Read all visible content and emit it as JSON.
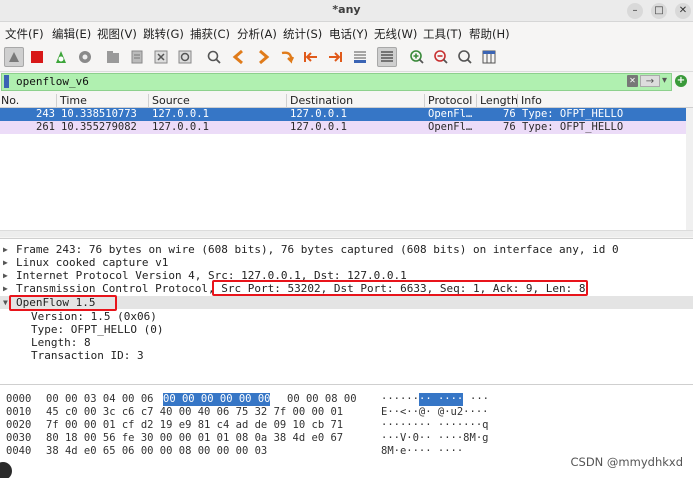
{
  "window": {
    "title": "*any",
    "min": "–",
    "max": "□",
    "close": "✕"
  },
  "menu": [
    "文件(F)",
    "编辑(E)",
    "视图(V)",
    "跳转(G)",
    "捕获(C)",
    "分析(A)",
    "统计(S)",
    "电话(Y)",
    "无线(W)",
    "工具(T)",
    "帮助(H)"
  ],
  "filter": {
    "value": "openflow_v6",
    "clear": "✕",
    "apply": "→",
    "dropdown": "▾",
    "add": "+"
  },
  "columns": [
    "No.",
    "Time",
    "Source",
    "Destination",
    "Protocol",
    "Length",
    "Info"
  ],
  "packets": [
    {
      "no": "243",
      "time": "10.338510773",
      "src": "127.0.0.1",
      "dst": "127.0.0.1",
      "proto": "OpenFl…",
      "len": "76",
      "info": "Type: OFPT_HELLO"
    },
    {
      "no": "261",
      "time": "10.355279082",
      "src": "127.0.0.1",
      "dst": "127.0.0.1",
      "proto": "OpenFl…",
      "len": "76",
      "info": "Type: OFPT_HELLO"
    }
  ],
  "details": {
    "frame": "Frame 243: 76 bytes on wire (608 bits), 76 bytes captured (608 bits) on interface any, id 0",
    "linux": "Linux cooked capture v1",
    "ip": "Internet Protocol Version 4, Src: 127.0.0.1, Dst: 127.0.0.1",
    "tcp": "Transmission Control Protocol, Src Port: 53202, Dst Port: 6633, Seq: 1, Ack: 9, Len: 8",
    "openflow": "OpenFlow 1.5",
    "version": "Version: 1.5 (0x06)",
    "type": "Type: OFPT_HELLO (0)",
    "length": "Length: 8",
    "xid": "Transaction ID: 3"
  },
  "hex": [
    {
      "off": "0000",
      "a": "00 00 03 04 00 06",
      "hl": "00 00  00 00 00 00",
      "b": "00 00 08 00",
      "asc1": "······",
      "asc_hl": "·· ····",
      "asc2": "···"
    },
    {
      "off": "0010",
      "a": "45 c0 00 3c c6 c7 40 00  40 06 75 32 7f 00 00 01",
      "hl": "",
      "b": "",
      "asc1": "E··<··@· @·u2····",
      "asc_hl": "",
      "asc2": ""
    },
    {
      "off": "0020",
      "a": "7f 00 00 01 cf d2 19 e9  81 c4 ad de 09 10 cb 71",
      "hl": "",
      "b": "",
      "asc1": "········ ·······q",
      "asc_hl": "",
      "asc2": ""
    },
    {
      "off": "0030",
      "a": "80 18 00 56 fe 30 00 00  01 01 08 0a 38 4d e0 67",
      "hl": "",
      "b": "",
      "asc1": "···V·0·· ····8M·g",
      "asc_hl": "",
      "asc2": ""
    },
    {
      "off": "0040",
      "a": "38 4d e0 65 06 00 00 08  00 00 00 03",
      "hl": "",
      "b": "",
      "asc1": "8M·e···· ····",
      "asc_hl": "",
      "asc2": ""
    }
  ],
  "watermark": "CSDN @mmydhkxd"
}
